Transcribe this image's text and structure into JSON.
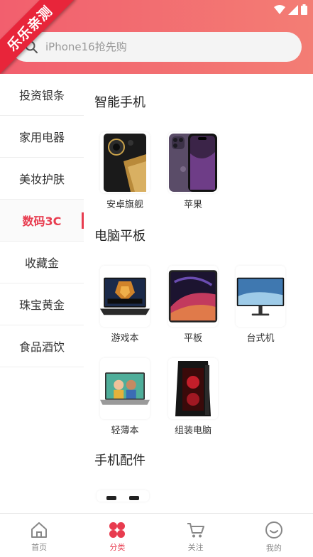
{
  "header": {
    "ribbon_text": "乐乐亲测",
    "search_placeholder": "iPhone16抢先购"
  },
  "sidebar": {
    "items": [
      {
        "label": "投资银条"
      },
      {
        "label": "家用电器"
      },
      {
        "label": "美妆护肤"
      },
      {
        "label": "数码3C",
        "active": true
      },
      {
        "label": "收藏金"
      },
      {
        "label": "珠宝黄金"
      },
      {
        "label": "食品酒饮"
      }
    ]
  },
  "content": {
    "sections": [
      {
        "title": "智能手机",
        "products": [
          {
            "label": "安卓旗舰"
          },
          {
            "label": "苹果"
          }
        ]
      },
      {
        "title": "电脑平板",
        "products": [
          {
            "label": "游戏本"
          },
          {
            "label": "平板"
          },
          {
            "label": "台式机"
          },
          {
            "label": "轻薄本"
          },
          {
            "label": "组装电脑"
          }
        ]
      },
      {
        "title": "手机配件",
        "products": []
      }
    ]
  },
  "tabbar": {
    "items": [
      {
        "label": "首页",
        "icon": "home-icon"
      },
      {
        "label": "分类",
        "icon": "category-icon",
        "active": true
      },
      {
        "label": "关注",
        "icon": "cart-icon"
      },
      {
        "label": "我的",
        "icon": "profile-icon"
      }
    ]
  },
  "colors": {
    "accent": "#e83c4f",
    "header_gradient_start": "#f25f6e",
    "header_gradient_end": "#f37d74"
  }
}
